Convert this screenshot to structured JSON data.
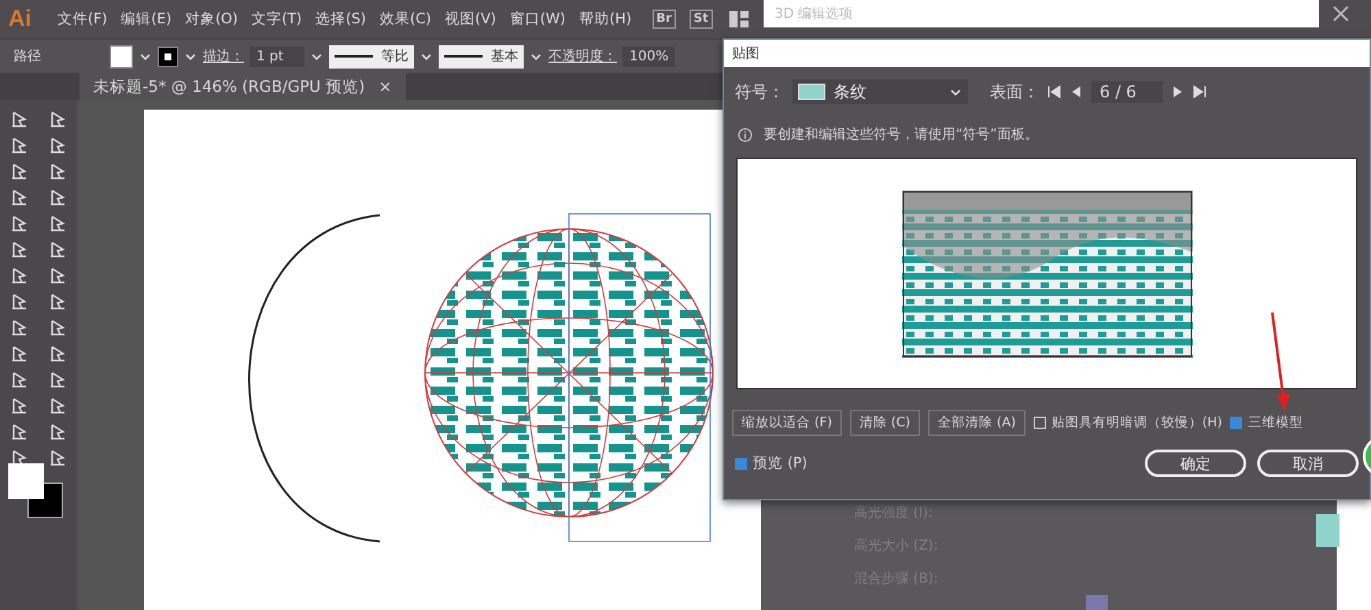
{
  "menu_bar": {
    "logo": "Ai",
    "items": [
      "文件(F)",
      "编辑(E)",
      "对象(O)",
      "文字(T)",
      "选择(S)",
      "效果(C)",
      "视图(V)",
      "窗口(W)",
      "帮助(H)"
    ],
    "bridge": "Br",
    "stock": "St"
  },
  "background_window": {
    "title": "3D 编辑选项"
  },
  "control_bar": {
    "object_type": "路径",
    "stroke_label": "描边：",
    "stroke_weight": "1 pt",
    "profile": "等比",
    "brush": "基本",
    "opacity_label": "不透明度：",
    "opacity": "100%"
  },
  "document_tab": {
    "title": "未标题-5* @ 146% (RGB/GPU 预览)",
    "close": "×"
  },
  "dialog": {
    "title": "贴图",
    "symbol_label": "符号：",
    "symbol": "条纹",
    "surface_label": "表面：",
    "surface": "6 / 6",
    "info": "要创建和编辑这些符号，请使用“符号”面板。",
    "buttons": [
      "缩放以适合 (F)",
      "清除 (C)",
      "全部清除 (A)"
    ],
    "options": [
      {
        "label": "贴图具有明暗调（较慢）(H)",
        "checked": false
      },
      {
        "label": "三维模型",
        "checked": true
      }
    ],
    "preview": {
      "label": "预览 (P)",
      "checked": true
    },
    "ok": "确定",
    "cancel": "取消"
  },
  "background_panel": {
    "fields": [
      "高光强度 (I):",
      "高光大小 (Z):",
      "混合步骤 (B):"
    ]
  }
}
